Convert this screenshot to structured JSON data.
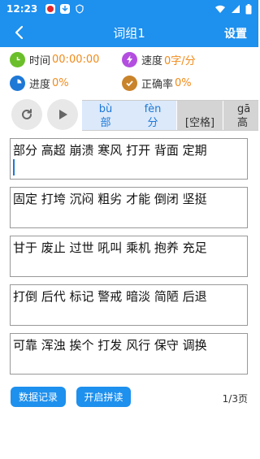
{
  "status_bar": {
    "time": "12:23"
  },
  "app_bar": {
    "title": "词组1",
    "settings_label": "设置"
  },
  "stats": {
    "time": {
      "label": "时间",
      "value": "00:00:00",
      "icon": "clock-icon",
      "color": "#6abf2a"
    },
    "speed": {
      "label": "速度",
      "value": "0字/分",
      "icon": "lightning-icon",
      "color": "#b44ee0"
    },
    "progress": {
      "label": "进度",
      "value": "0%",
      "icon": "pie-chart-icon",
      "color": "#1e78d6"
    },
    "accuracy": {
      "label": "正确率",
      "value": "0%",
      "icon": "check-icon",
      "color": "#c9832a"
    }
  },
  "pinyin_strip": [
    {
      "pinyin": "bù",
      "char": "部"
    },
    {
      "pinyin": "fèn",
      "char": "分"
    },
    {
      "pinyin": "",
      "char": "[空格]"
    },
    {
      "pinyin": "gā",
      "char": "高"
    }
  ],
  "text_blocks": [
    "部分 高超 崩溃 寒风 打开 背面 定期",
    "固定 打垮 沉闷 粗劣 才能 倒闭 坚挺",
    "甘于 废止 过世 吼叫 乘机 抱养 充足",
    "打倒 后代 标记 警戒 暗淡 简陋 后退",
    "可靠 浑浊 挨个 打发 风行 保守 调换"
  ],
  "footer": {
    "records_button": "数据记录",
    "pinyin_button": "开启拼读",
    "page_indicator": "1/3页"
  },
  "colors": {
    "accent": "#1e90ee",
    "value_orange": "#f08a1a"
  }
}
